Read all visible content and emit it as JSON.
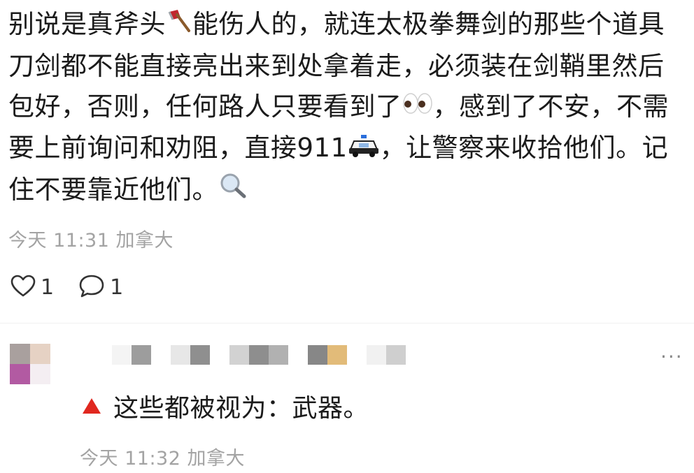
{
  "post": {
    "segments": [
      "别说是真斧头",
      "能伤人的，就连太极拳舞剑的那些个道具刀剑都不能直接亮出来到处拿着走，必须装在剑鞘里然后包好，否则，任何路人只要看到了",
      "，感到了不安，不需要上前询问和劝阻，直接911",
      "，让警察来收拾他们。记住不要靠近他们。"
    ],
    "emojis": [
      "axe-icon",
      "eyes-icon",
      "police-car-icon",
      "magnifier-icon"
    ],
    "timestamp": "今天 11:31",
    "location": "加拿大",
    "like_count": "1",
    "comment_count": "1"
  },
  "reply": {
    "icon": "red-triangle-icon",
    "text": "这些都被视为：武器。",
    "timestamp": "今天 11:32",
    "location": "加拿大",
    "more_label": "···"
  },
  "colors": {
    "text": "#1b1b1b",
    "meta": "#a3a3a3",
    "red_triangle": "#e0271f"
  }
}
